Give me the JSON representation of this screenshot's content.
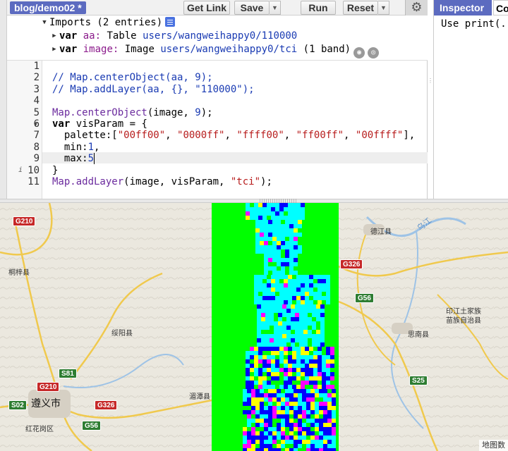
{
  "toolbar": {
    "script_title": "blog/demo02 *",
    "get_link_label": "Get Link",
    "save_label": "Save",
    "run_label": "Run",
    "reset_label": "Reset",
    "gear_icon": "gear-icon"
  },
  "imports": {
    "header": "Imports (2 entries)",
    "items": [
      {
        "kw": "var",
        "name": "aa:",
        "type": "Table",
        "path": "users/wangweihappy0/110000",
        "extra": ""
      },
      {
        "kw": "var",
        "name": "image:",
        "type": "Image",
        "path": "users/wangweihappy0/tci",
        "extra": "(1 band)"
      }
    ]
  },
  "code": {
    "line_numbers": [
      "1",
      "2",
      "3",
      "4",
      "5",
      "6",
      "7",
      "8",
      "9",
      "10",
      "11"
    ],
    "l2": "// Map.centerObject(aa, 9);",
    "l3": "// Map.addLayer(aa, {}, \"110000\");",
    "l5_fn": "Map.centerObject",
    "l5_rest_a": "(image, ",
    "l5_num": "9",
    "l5_rest_b": ");",
    "l6_kw": "var",
    "l6_rest": " visParam = {",
    "l7_key": "  palette:[",
    "l7_s1": "\"00ff00\"",
    "l7_s2": "\"0000ff\"",
    "l7_s3": "\"ffff00\"",
    "l7_s4": "\"ff00ff\"",
    "l7_s5": "\"00ffff\"",
    "l7_sep": ", ",
    "l7_end": "],",
    "l8_key": "  min:",
    "l8_num": "1",
    "l8_end": ",",
    "l9_key": "  max:",
    "l9_num": "5",
    "l10": "}",
    "l11_fn": "Map.addLayer",
    "l11_rest_a": "(image, visParam, ",
    "l11_str": "\"tci\"",
    "l11_rest_b": ");"
  },
  "inspector": {
    "inspector_tab": "Inspector",
    "console_tab": "Co",
    "console_text": "Use print(."
  },
  "map": {
    "places": {
      "tongzi": "桐梓县",
      "suiyang": "绥阳县",
      "zunyi": "遵义市",
      "meitan": "湄潭县",
      "honghuagang": "红花岗区",
      "dejiang": "德江县",
      "yinjiang": "印江土家族\n苗族自治县",
      "sinan": "思南县",
      "wujiang": "乌江"
    },
    "shields": {
      "g210a": "G210",
      "g210b": "G210",
      "s81": "S81",
      "s02": "S02",
      "g326a": "G326",
      "g326b": "G326",
      "g56a": "G56",
      "g56b": "G56",
      "s25": "S25"
    },
    "attribution": "地图数"
  },
  "palette": [
    "#00ff00",
    "#0000ff",
    "#ffff00",
    "#ff00ff",
    "#00ffff"
  ]
}
